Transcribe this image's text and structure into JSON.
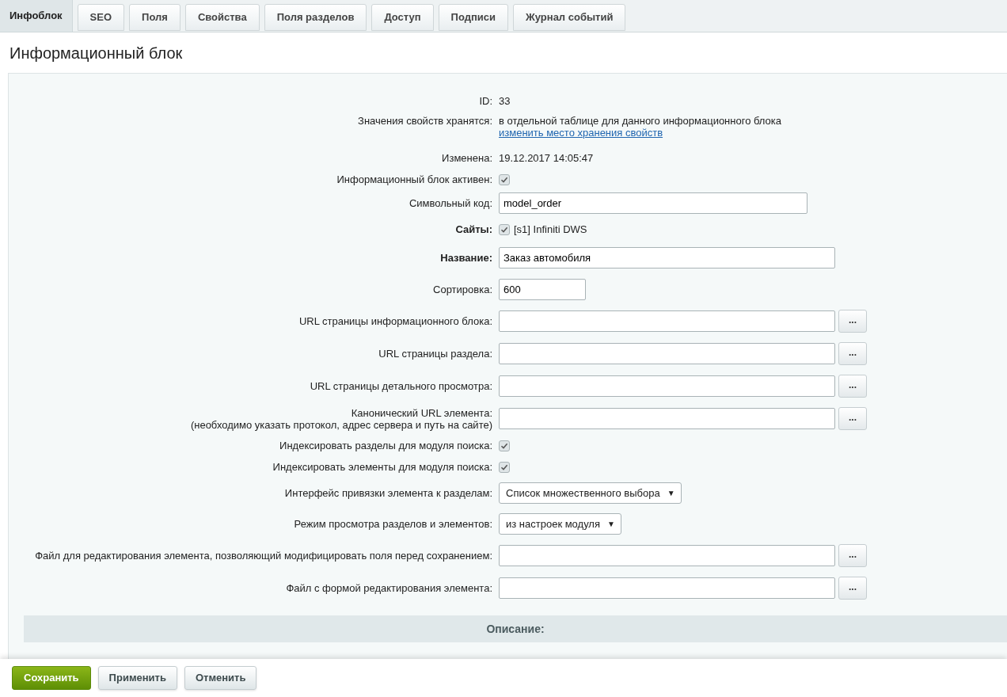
{
  "tabs": [
    {
      "label": "Инфоблок",
      "selected": true
    },
    {
      "label": "SEO",
      "selected": false
    },
    {
      "label": "Поля",
      "selected": false
    },
    {
      "label": "Свойства",
      "selected": false
    },
    {
      "label": "Поля разделов",
      "selected": false
    },
    {
      "label": "Доступ",
      "selected": false
    },
    {
      "label": "Подписи",
      "selected": false
    },
    {
      "label": "Журнал событий",
      "selected": false
    }
  ],
  "title": "Информационный блок",
  "fields": [
    {
      "kind": "text",
      "label": "ID:",
      "value": "33"
    },
    {
      "kind": "text_link",
      "label": "Значения свойств хранятся:",
      "value": "в отдельной таблице для данного информационного блока",
      "link": "изменить место хранения свойств"
    },
    {
      "kind": "text",
      "label": "Изменена:",
      "value": "19.12.2017 14:05:47"
    },
    {
      "kind": "checkbox",
      "label": "Информационный блок активен:",
      "checked": true
    },
    {
      "kind": "codefield",
      "label": "Символьный код:",
      "value": "model_order"
    },
    {
      "kind": "checkbox",
      "label": "Сайты:",
      "bold": true,
      "checked": true,
      "option": "[s1] Infiniti DWS"
    },
    {
      "kind": "textfield",
      "label": "Название:",
      "bold": true,
      "value": "Заказ автомобиля"
    },
    {
      "kind": "numberfield",
      "label": "Сортировка:",
      "value": "600"
    },
    {
      "kind": "browse",
      "label": "URL страницы информационного блока:",
      "button": "..."
    },
    {
      "kind": "browse",
      "label": "URL страницы раздела:",
      "button": "..."
    },
    {
      "kind": "browse",
      "label": "URL страницы детального просмотра:",
      "button": "..."
    },
    {
      "kind": "browse",
      "label": "Канонический URL элемента:",
      "note": "(необходимо указать протокол, адрес сервера и путь на сайте)",
      "button": "..."
    },
    {
      "kind": "checkbox",
      "label": "Индексировать разделы для модуля поиска:",
      "checked": true
    },
    {
      "kind": "checkbox",
      "label": "Индексировать элементы для модуля поиска:",
      "checked": true
    },
    {
      "kind": "select",
      "label": "Интерфейс привязки элемента к разделам:",
      "value": "Список множественного выбора",
      "arrow": "▼"
    },
    {
      "kind": "select",
      "label": "Режим просмотра разделов и элементов:",
      "value": "из настроек модуля",
      "arrow": "▼"
    },
    {
      "kind": "browse",
      "label": "Файл для редактирования элемента, позволяющий модифицировать поля перед сохранением:",
      "button": "..."
    },
    {
      "kind": "browse",
      "label": "Файл с формой редактирования элемента:",
      "button": "..."
    }
  ],
  "section": "Описание:",
  "buttons": [
    {
      "label": "Сохранить",
      "primary": true
    },
    {
      "label": "Применить",
      "primary": false
    },
    {
      "label": "Отменить",
      "primary": false
    }
  ]
}
